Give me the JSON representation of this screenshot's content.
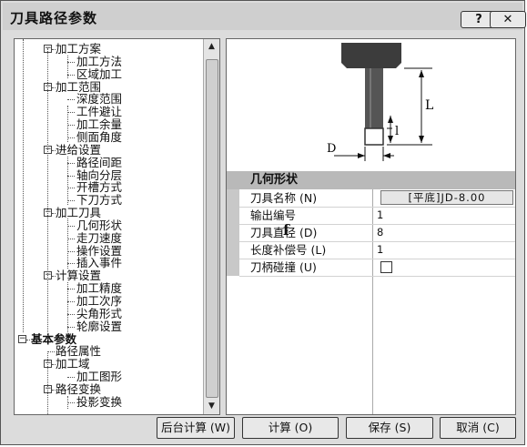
{
  "window": {
    "title": "刀具路径参数",
    "help_label": "?",
    "close_label": "✕"
  },
  "tree": {
    "nodes": [
      {
        "label": "加工方案",
        "level": 1,
        "expander": "−"
      },
      {
        "label": "加工方法",
        "level": 2
      },
      {
        "label": "区域加工",
        "level": 2
      },
      {
        "label": "加工范围",
        "level": 1,
        "expander": "−"
      },
      {
        "label": "深度范围",
        "level": 2
      },
      {
        "label": "工件避让",
        "level": 2
      },
      {
        "label": "加工余量",
        "level": 2
      },
      {
        "label": "侧面角度",
        "level": 2
      },
      {
        "label": "进给设置",
        "level": 1,
        "expander": "−"
      },
      {
        "label": "路径间距",
        "level": 2
      },
      {
        "label": "轴向分层",
        "level": 2
      },
      {
        "label": "开槽方式",
        "level": 2
      },
      {
        "label": "下刀方式",
        "level": 2
      },
      {
        "label": "加工刀具",
        "level": 1,
        "expander": "−"
      },
      {
        "label": "几何形状",
        "level": 2
      },
      {
        "label": "走刀速度",
        "level": 2
      },
      {
        "label": "操作设置",
        "level": 2
      },
      {
        "label": "插入事件",
        "level": 2
      },
      {
        "label": "计算设置",
        "level": 1,
        "expander": "−"
      },
      {
        "label": "加工精度",
        "level": 2
      },
      {
        "label": "加工次序",
        "level": 2
      },
      {
        "label": "尖角形式",
        "level": 2
      },
      {
        "label": "轮廓设置",
        "level": 2
      },
      {
        "label": "基本参数",
        "level": 0,
        "expander": "−",
        "bold": true
      },
      {
        "label": "路径属性",
        "level": 1
      },
      {
        "label": "加工域",
        "level": 1,
        "expander": "−"
      },
      {
        "label": "加工图形",
        "level": 2
      },
      {
        "label": "路径变换",
        "level": 1,
        "expander": "−"
      },
      {
        "label": "投影变换",
        "level": 2
      }
    ]
  },
  "diagram": {
    "label_L": "L",
    "label_l": "l",
    "label_D": "D"
  },
  "grid": {
    "header": "几何形状",
    "rows": [
      {
        "label": "刀具名称 (N)",
        "value": "[平底]JD-8.00",
        "kind": "button"
      },
      {
        "label": "输出编号",
        "value": "1",
        "kind": "text"
      },
      {
        "label": "刀具直径 (D)",
        "value": "8",
        "kind": "text"
      },
      {
        "label": "长度补偿号 (L)",
        "value": "1",
        "kind": "text"
      },
      {
        "label": "刀柄碰撞 (U)",
        "value": "",
        "kind": "checkbox",
        "checked": false
      }
    ],
    "margin_mark": "f"
  },
  "buttons": {
    "background_calc": "后台计算 (W)",
    "calc": "计算 (O)",
    "save": "保存 (S)",
    "cancel": "取消 (C)"
  }
}
